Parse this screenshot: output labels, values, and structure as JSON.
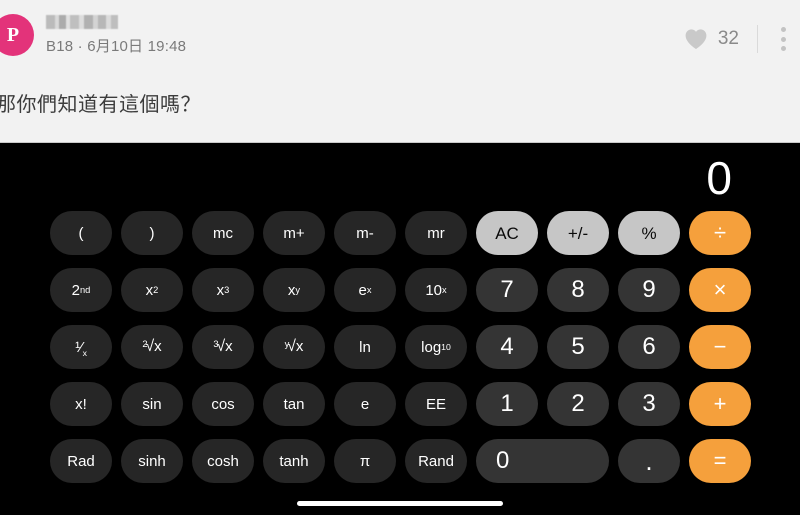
{
  "post": {
    "avatar_letter": "P",
    "avatar_color": "#e3337a",
    "username": "",
    "meta": "B18 · 6月10日 19:48",
    "body": "那你們知道有這個嗎？",
    "like_count": "32",
    "icons": {
      "heart": "heart-icon",
      "more": "more-vertical-icon"
    }
  },
  "calculator": {
    "display_value": "0",
    "accent_color": "#f5a03c",
    "util_color": "#c6c6c6",
    "keys": [
      {
        "label": "(",
        "name": "key-open-paren",
        "type": "fn"
      },
      {
        "label": ")",
        "name": "key-close-paren",
        "type": "fn"
      },
      {
        "label": "mc",
        "name": "key-mc",
        "type": "fn"
      },
      {
        "label": "m+",
        "name": "key-m-plus",
        "type": "fn"
      },
      {
        "label": "m-",
        "name": "key-m-minus",
        "type": "fn"
      },
      {
        "label": "mr",
        "name": "key-mr",
        "type": "fn"
      },
      {
        "label": "AC",
        "name": "key-ac",
        "type": "util"
      },
      {
        "label": "+/-",
        "name": "key-sign",
        "type": "util"
      },
      {
        "label": "%",
        "name": "key-percent",
        "type": "util"
      },
      {
        "label": "÷",
        "name": "key-divide",
        "type": "op"
      },
      {
        "label": "2nd",
        "name": "key-second",
        "type": "fn",
        "html": "2<sup>nd</sup>"
      },
      {
        "label": "x²",
        "name": "key-x-squared",
        "type": "fn",
        "html": "x<sup>2</sup>"
      },
      {
        "label": "x³",
        "name": "key-x-cubed",
        "type": "fn",
        "html": "x<sup>3</sup>"
      },
      {
        "label": "xʸ",
        "name": "key-x-power-y",
        "type": "fn",
        "html": "x<sup>y</sup>"
      },
      {
        "label": "eˣ",
        "name": "key-e-power-x",
        "type": "fn",
        "html": "e<sup>x</sup>"
      },
      {
        "label": "10ˣ",
        "name": "key-ten-power-x",
        "type": "fn",
        "html": "10<sup>x</sup>"
      },
      {
        "label": "7",
        "name": "key-7",
        "type": "num"
      },
      {
        "label": "8",
        "name": "key-8",
        "type": "num"
      },
      {
        "label": "9",
        "name": "key-9",
        "type": "num"
      },
      {
        "label": "×",
        "name": "key-multiply",
        "type": "op"
      },
      {
        "label": "1/x",
        "name": "key-reciprocal",
        "type": "fn",
        "html": "<span class=\"frac\">¹⁄<sub>x</sub></span>"
      },
      {
        "label": "²√x",
        "name": "key-square-root",
        "type": "fn",
        "html": "<span class=\"radical\"><span class=\"idx\">2</span><span class=\"rad\">√</span>x</span>"
      },
      {
        "label": "³√x",
        "name": "key-cube-root",
        "type": "fn",
        "html": "<span class=\"radical\"><span class=\"idx\">3</span><span class=\"rad\">√</span>x</span>"
      },
      {
        "label": "ʸ√x",
        "name": "key-nth-root",
        "type": "fn",
        "html": "<span class=\"radical\"><span class=\"idx\">y</span><span class=\"rad\">√</span>x</span>"
      },
      {
        "label": "ln",
        "name": "key-ln",
        "type": "fn"
      },
      {
        "label": "log10",
        "name": "key-log10",
        "type": "fn",
        "html": "log<sub>10</sub>"
      },
      {
        "label": "4",
        "name": "key-4",
        "type": "num"
      },
      {
        "label": "5",
        "name": "key-5",
        "type": "num"
      },
      {
        "label": "6",
        "name": "key-6",
        "type": "num"
      },
      {
        "label": "−",
        "name": "key-subtract",
        "type": "op"
      },
      {
        "label": "x!",
        "name": "key-factorial",
        "type": "fn"
      },
      {
        "label": "sin",
        "name": "key-sin",
        "type": "fn"
      },
      {
        "label": "cos",
        "name": "key-cos",
        "type": "fn"
      },
      {
        "label": "tan",
        "name": "key-tan",
        "type": "fn"
      },
      {
        "label": "e",
        "name": "key-euler",
        "type": "fn"
      },
      {
        "label": "EE",
        "name": "key-ee",
        "type": "fn"
      },
      {
        "label": "1",
        "name": "key-1",
        "type": "num"
      },
      {
        "label": "2",
        "name": "key-2",
        "type": "num"
      },
      {
        "label": "3",
        "name": "key-3",
        "type": "num"
      },
      {
        "label": "+",
        "name": "key-add",
        "type": "op"
      },
      {
        "label": "Rad",
        "name": "key-rad",
        "type": "fn"
      },
      {
        "label": "sinh",
        "name": "key-sinh",
        "type": "fn"
      },
      {
        "label": "cosh",
        "name": "key-cosh",
        "type": "fn"
      },
      {
        "label": "tanh",
        "name": "key-tanh",
        "type": "fn"
      },
      {
        "label": "π",
        "name": "key-pi",
        "type": "fn"
      },
      {
        "label": "Rand",
        "name": "key-rand",
        "type": "fn"
      },
      {
        "label": "0",
        "name": "key-0",
        "type": "num zero"
      },
      {
        "label": ".",
        "name": "key-decimal",
        "type": "num dot"
      },
      {
        "label": "=",
        "name": "key-equals",
        "type": "op"
      }
    ]
  }
}
